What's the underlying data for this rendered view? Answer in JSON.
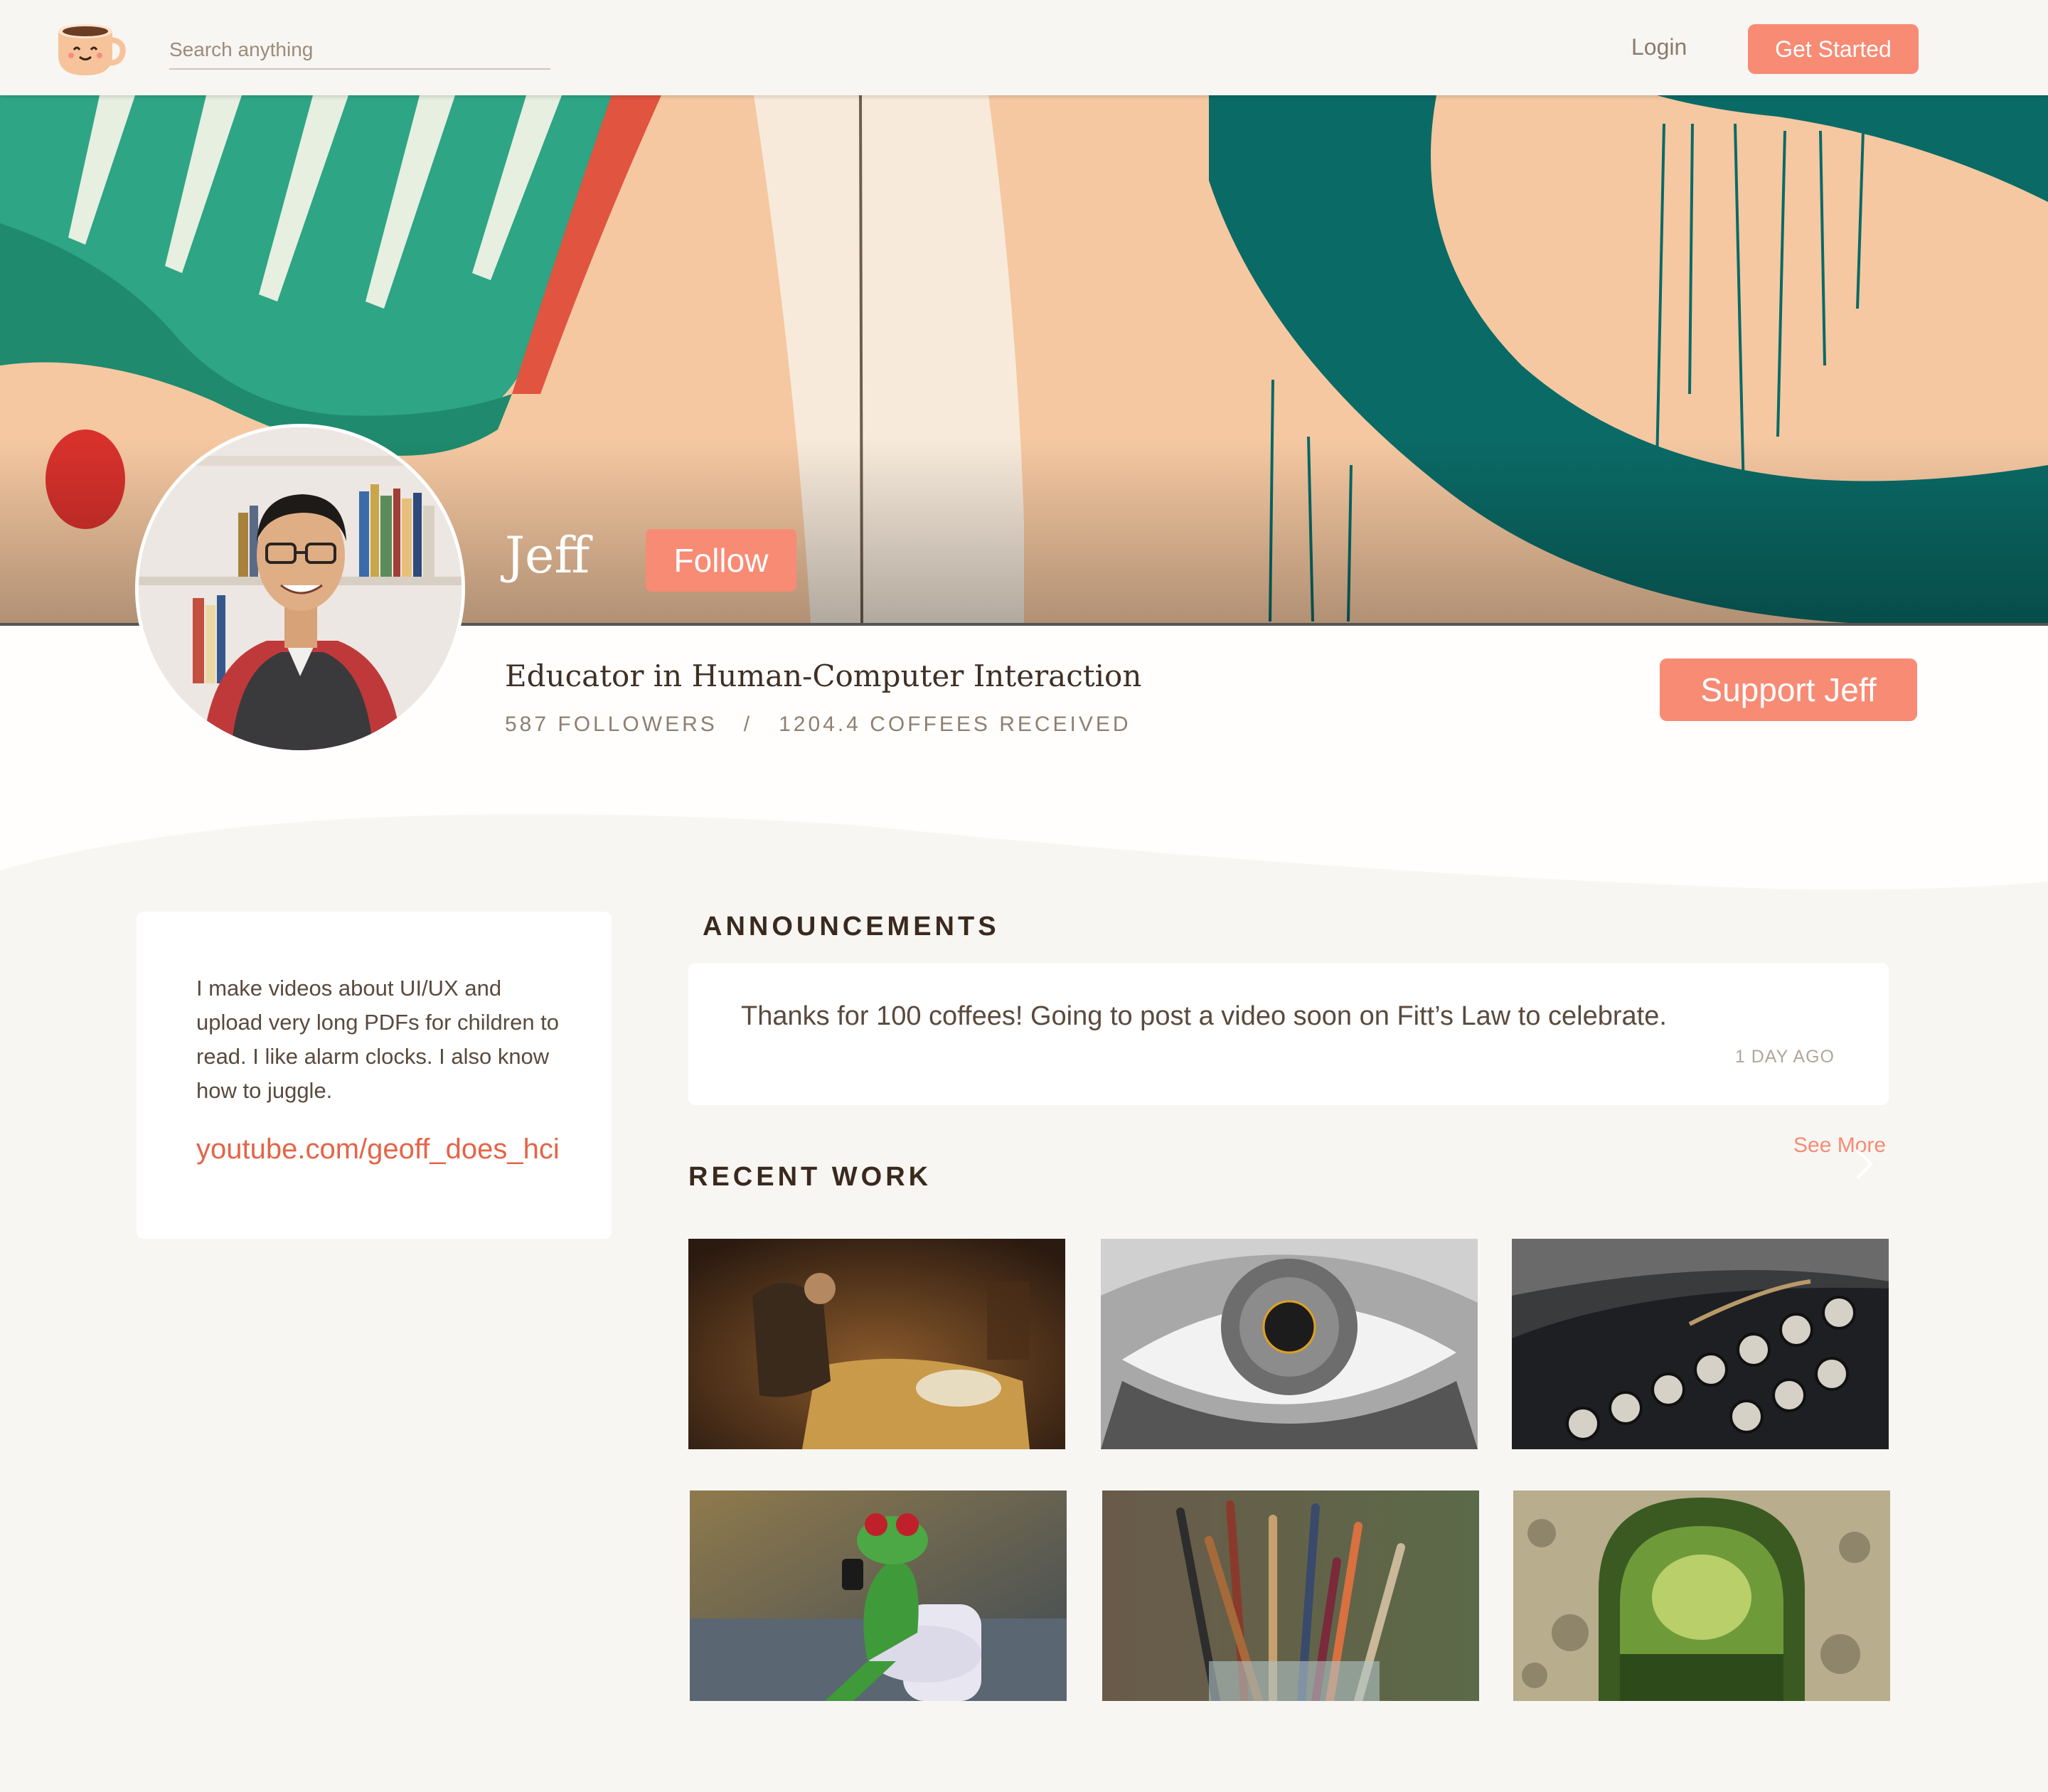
{
  "navbar": {
    "logo_icon": "coffee-cup-icon",
    "search_placeholder": "Search anything",
    "login_label": "Login",
    "get_started_label": "Get Started"
  },
  "profile": {
    "name": "Jeff",
    "follow_label": "Follow",
    "tagline": "Educator in Human-Computer Interaction",
    "stats": "587 FOLLOWERS   /   1204.4 COFFEES RECEIVED",
    "support_label": "Support Jeff"
  },
  "bio": {
    "text": "I make videos about UI/UX and upload very long PDFs for children to read. I like alarm clocks. I also know how to juggle.",
    "link": "youtube.com/geoff_does_hci"
  },
  "announcements": {
    "title": "ANNOUNCEMENTS",
    "items": [
      {
        "text": "Thanks for 100 coffees! Going to post a video soon on Fitt’s Law to celebrate.",
        "time": "1 DAY AGO"
      }
    ]
  },
  "recent_work": {
    "title": "RECENT WORK",
    "see_more_label": "See More",
    "items": [
      {
        "icon": "painting-thumbnail"
      },
      {
        "icon": "eye-thumbnail"
      },
      {
        "icon": "typewriter-thumbnail"
      },
      {
        "icon": "frog-thumbnail"
      },
      {
        "icon": "paintbrushes-thumbnail"
      },
      {
        "icon": "stone-archway-thumbnail"
      }
    ]
  },
  "colors": {
    "accent": "#f78b74",
    "link": "#e56447",
    "background": "#f8f6f3"
  }
}
